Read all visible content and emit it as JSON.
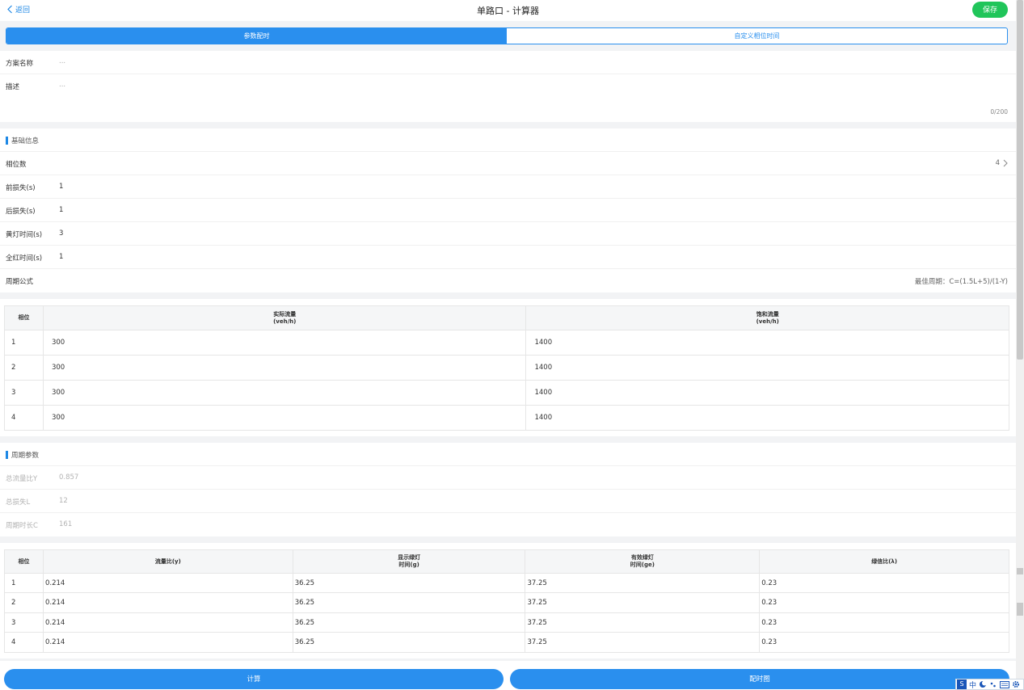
{
  "header": {
    "back_label": "返回",
    "title": "单路口 - 计算器",
    "save_label": "保存"
  },
  "tabs": [
    {
      "label": "参数配时",
      "active": true
    },
    {
      "label": "自定义相位时间",
      "active": false
    }
  ],
  "scheme": {
    "name_label": "方案名称",
    "name_placeholder": "...",
    "desc_label": "描述",
    "desc_placeholder": "...",
    "counter": "0/200"
  },
  "basic": {
    "title": "基础信息",
    "phase_count_label": "相位数",
    "phase_count_value": "4",
    "front_loss_label": "前损失(s)",
    "front_loss_value": "1",
    "back_loss_label": "后损失(s)",
    "back_loss_value": "1",
    "yellow_label": "黄灯时间(s)",
    "yellow_value": "3",
    "allred_label": "全红时间(s)",
    "allred_value": "1",
    "formula_label": "周期公式",
    "formula_value": "最佳周期：C=(1.5L+5)/(1-Y)"
  },
  "flow_table": {
    "headers": [
      {
        "line1": "相位",
        "line2": ""
      },
      {
        "line1": "实际流量",
        "line2": "(veh/h)"
      },
      {
        "line1": "饱和流量",
        "line2": "(veh/h)"
      }
    ],
    "rows": [
      [
        "1",
        "300",
        "1400"
      ],
      [
        "2",
        "300",
        "1400"
      ],
      [
        "3",
        "300",
        "1400"
      ],
      [
        "4",
        "300",
        "1400"
      ]
    ]
  },
  "cycle": {
    "title": "周期参数",
    "y_label": "总流量比Y",
    "y_value": "0.857",
    "l_label": "总损失L",
    "l_value": "12",
    "c_label": "周期时长C",
    "c_value": "161"
  },
  "result_table": {
    "headers": [
      {
        "line1": "相位",
        "line2": ""
      },
      {
        "line1": "流量比(y)",
        "line2": ""
      },
      {
        "line1": "显示绿灯",
        "line2": "时间(g)"
      },
      {
        "line1": "有效绿灯",
        "line2": "时间(ge)"
      },
      {
        "line1": "绿信比(λ)",
        "line2": ""
      }
    ],
    "rows": [
      [
        "1",
        "0.214",
        "36.25",
        "37.25",
        "0.23"
      ],
      [
        "2",
        "0.214",
        "36.25",
        "37.25",
        "0.23"
      ],
      [
        "3",
        "0.214",
        "36.25",
        "37.25",
        "0.23"
      ],
      [
        "4",
        "0.214",
        "36.25",
        "37.25",
        "0.23"
      ]
    ]
  },
  "actions": {
    "calculate_label": "计算",
    "timing_chart_label": "配时图"
  },
  "ime": {
    "logo": "S",
    "mode": "中"
  },
  "colors": {
    "primary": "#2a8fee",
    "save": "#20c55a",
    "muted": "#b3b3b3"
  }
}
